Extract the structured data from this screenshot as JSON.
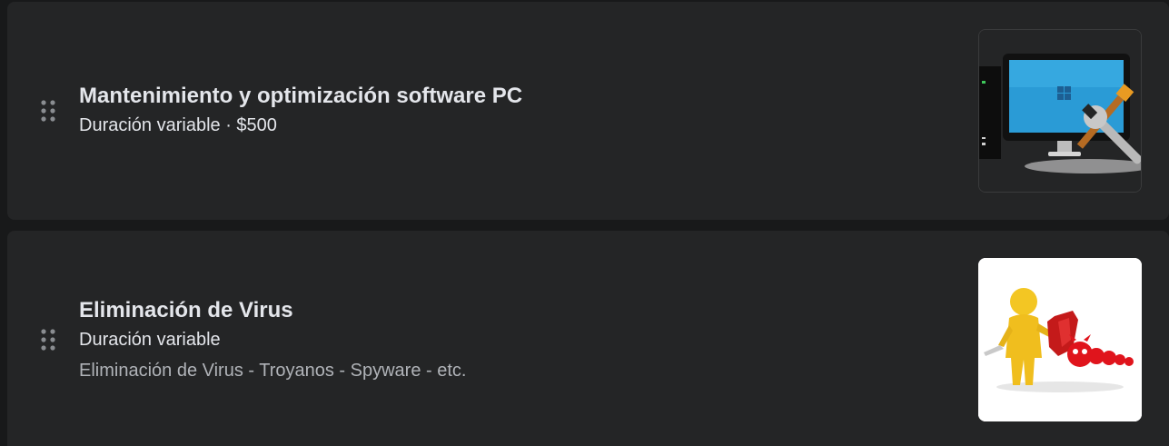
{
  "services": [
    {
      "title": "Mantenimiento y optimización software PC",
      "subtitle": "Duración variable · $500",
      "description": "",
      "image": "computer-maintenance-image"
    },
    {
      "title": "Eliminación de Virus",
      "subtitle": "Duración variable",
      "description": "Eliminación de Virus - Troyanos - Spyware - etc.",
      "image": "virus-removal-image"
    }
  ],
  "colors": {
    "background": "#18191a",
    "card": "#242526",
    "primary_text": "#e4e6eb",
    "secondary_text": "#b0b3b8"
  }
}
